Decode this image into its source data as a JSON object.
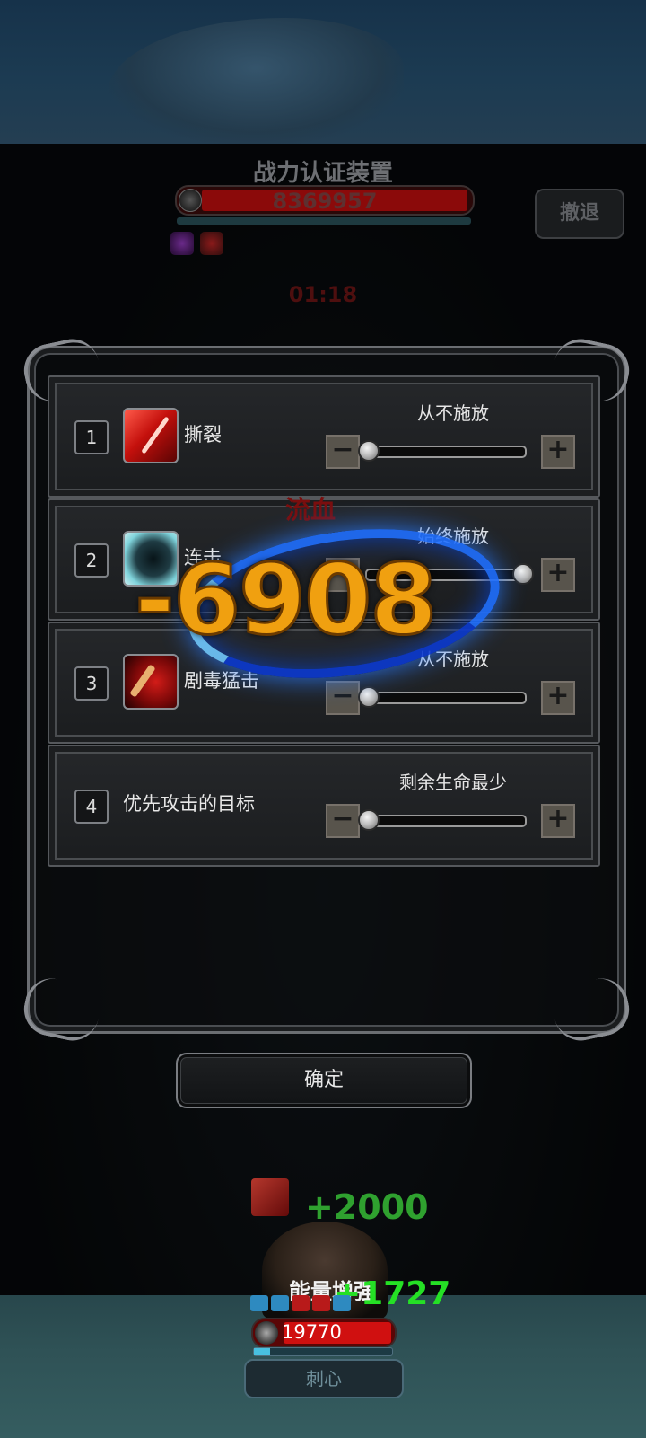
{
  "hud": {
    "title": "战力认证装置",
    "boss_hp": "8369957",
    "retreat_label": "撤退",
    "timer": "01:18"
  },
  "panel": {
    "rows": [
      {
        "index": "1",
        "name": "撕裂",
        "icon": "tear-skill-icon",
        "setting": "从不施放",
        "slider_level": 0.0
      },
      {
        "index": "2",
        "name": "连击",
        "icon": "combo-skill-icon",
        "setting": "始终施放",
        "slider_level": 1.0
      },
      {
        "index": "3",
        "name": "剧毒猛击",
        "icon": "poison-strike-skill-icon",
        "setting": "从不施放",
        "slider_level": 0.0
      },
      {
        "index": "4",
        "name": "优先攻击的目标",
        "setting": "剩余生命最少",
        "slider_level": 0.0
      }
    ],
    "minus": "−",
    "plus": "+"
  },
  "confirm_label": "确定",
  "floating": {
    "bleed": "流血",
    "big_damage": "-6908",
    "heal_1": "+2000",
    "heal_2": "+1727"
  },
  "hero": {
    "label": "能量增强",
    "hp": "19770",
    "mp_level": 0.12,
    "skill": "刺心"
  },
  "colors": {
    "damage": "#f0a010",
    "heal": "#25e025",
    "hp": "#d01010"
  }
}
